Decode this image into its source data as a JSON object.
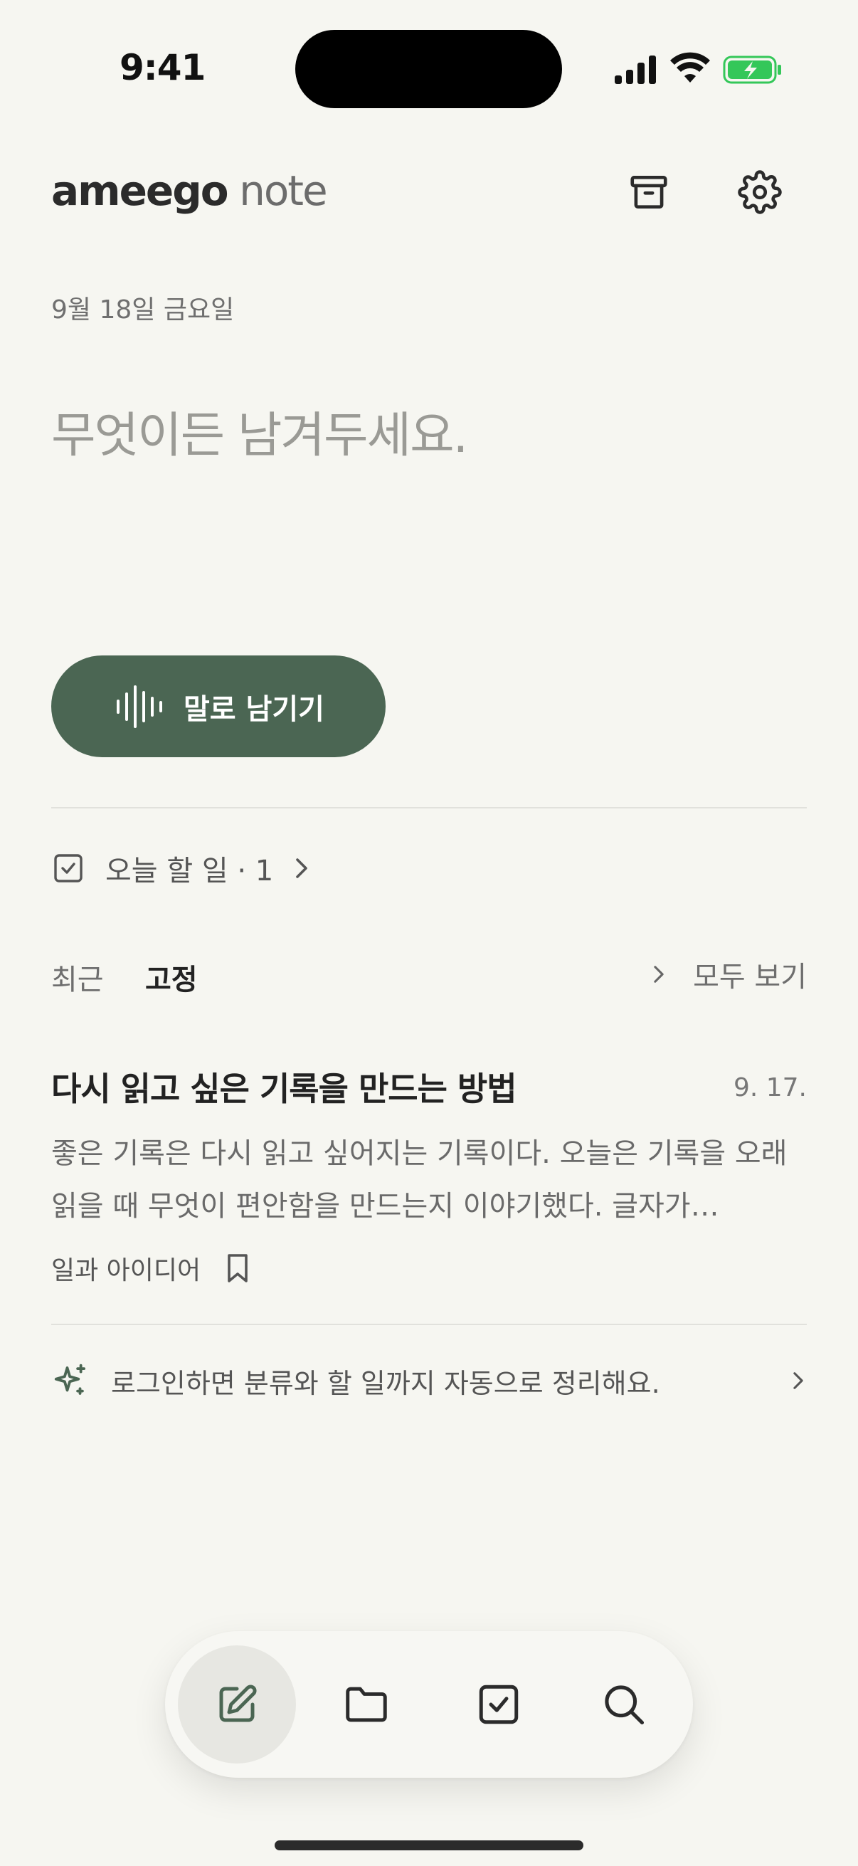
{
  "status_bar": {
    "time": "9:41"
  },
  "header": {
    "brand_bold": "ameego",
    "brand_light": "note",
    "archive_icon": "archive-icon",
    "settings_icon": "gear-icon"
  },
  "date": "9월 18일 금요일",
  "composer": {
    "placeholder": "무엇이든 남겨두세요."
  },
  "voice_button": {
    "label": "말로 남기기",
    "icon": "waveform-icon"
  },
  "todo": {
    "label": "오늘 할 일 · 1"
  },
  "tabs": {
    "recent": "최근",
    "pinned": "고정",
    "see_all": "모두 보기"
  },
  "note": {
    "title": "다시 읽고 싶은 기록을 만드는 방법",
    "date": "9. 17.",
    "body": "좋은 기록은 다시 읽고 싶어지는 기록이다. 오늘은 기록을 오래 읽을 때 무엇이 편안함을 만드는지 이야기했다. 글자가…",
    "category": "일과 아이디어"
  },
  "login_prompt": {
    "label": "로그인하면 분류와 할 일까지 자동으로 정리해요."
  },
  "bottom_nav": {
    "items": [
      "compose-icon",
      "folder-icon",
      "checkbox-icon",
      "search-icon"
    ],
    "active": "compose-icon"
  },
  "colors": {
    "accent": "#4b6653",
    "background": "#f6f6f1",
    "battery": "#34c759"
  }
}
